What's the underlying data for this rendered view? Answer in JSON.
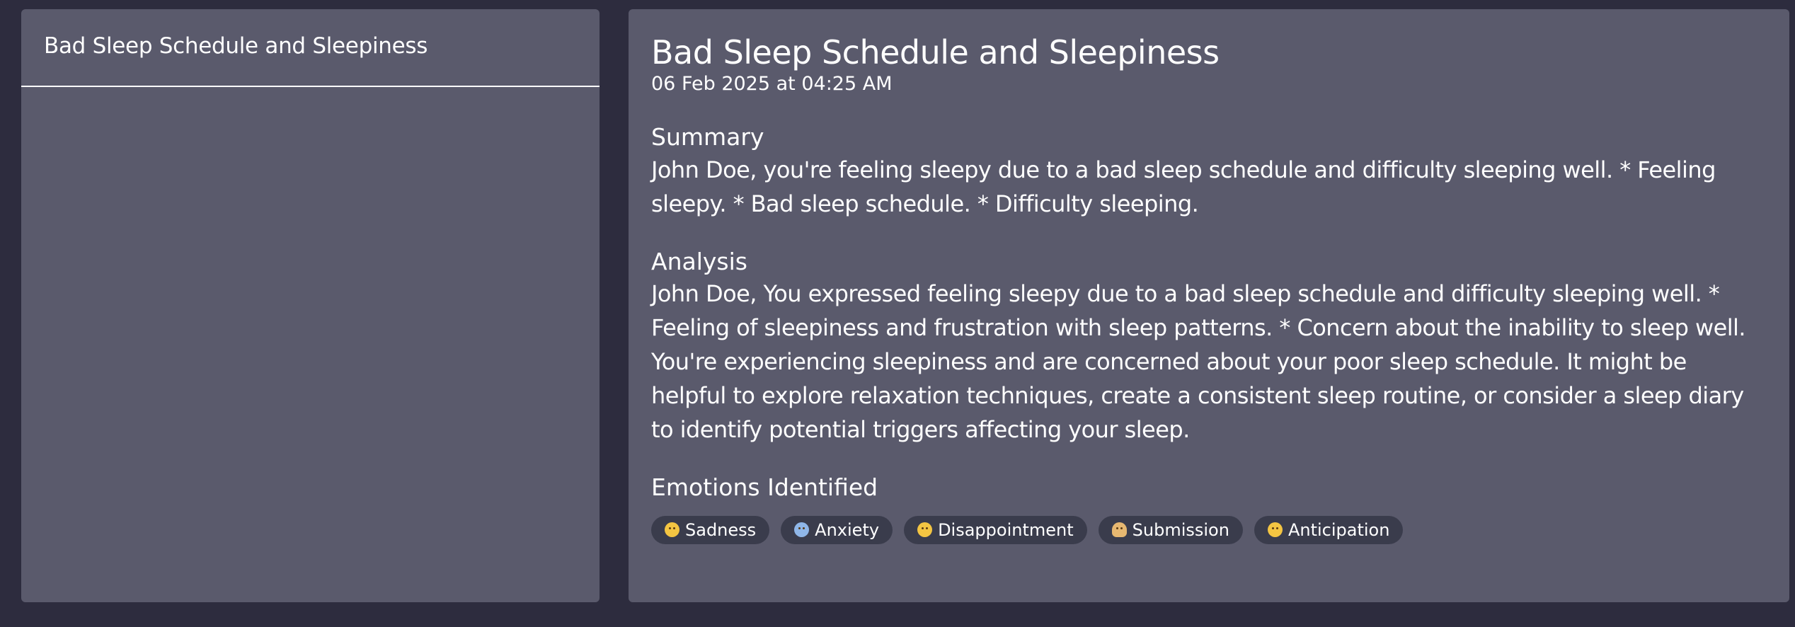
{
  "sidebar": {
    "items": [
      {
        "label": "Bad Sleep Schedule and Sleepiness"
      }
    ]
  },
  "entry": {
    "title": "Bad Sleep Schedule and Sleepiness",
    "timestamp": "06 Feb 2025 at 04:25 AM",
    "summary": {
      "heading": "Summary",
      "text": "John Doe, you're feeling sleepy due to a bad sleep schedule and difficulty sleeping well. * Feeling sleepy. * Bad sleep schedule. * Difficulty sleeping."
    },
    "analysis": {
      "heading": "Analysis",
      "text": "John Doe, You expressed feeling sleepy due to a bad sleep schedule and difficulty sleeping well. * Feeling of sleepiness and frustration with sleep patterns. * Concern about the inability to sleep well. You're experiencing sleepiness and are concerned about your poor sleep schedule. It might be helpful to explore relaxation techniques, create a consistent sleep routine, or consider a sleep diary to identify potential triggers affecting your sleep."
    },
    "emotions": {
      "heading": "Emotions Identified",
      "items": [
        {
          "label": "Sadness",
          "icon": "sad-face-icon"
        },
        {
          "label": "Anxiety",
          "icon": "anxious-face-icon"
        },
        {
          "label": "Disappointment",
          "icon": "disappointed-face-icon"
        },
        {
          "label": "Submission",
          "icon": "bowing-person-icon"
        },
        {
          "label": "Anticipation",
          "icon": "thinking-face-icon"
        }
      ]
    }
  },
  "colors": {
    "background": "#2d2c3e",
    "panel": "#5a5a6c",
    "chip": "#3a3c4c",
    "text": "#ffffff"
  }
}
